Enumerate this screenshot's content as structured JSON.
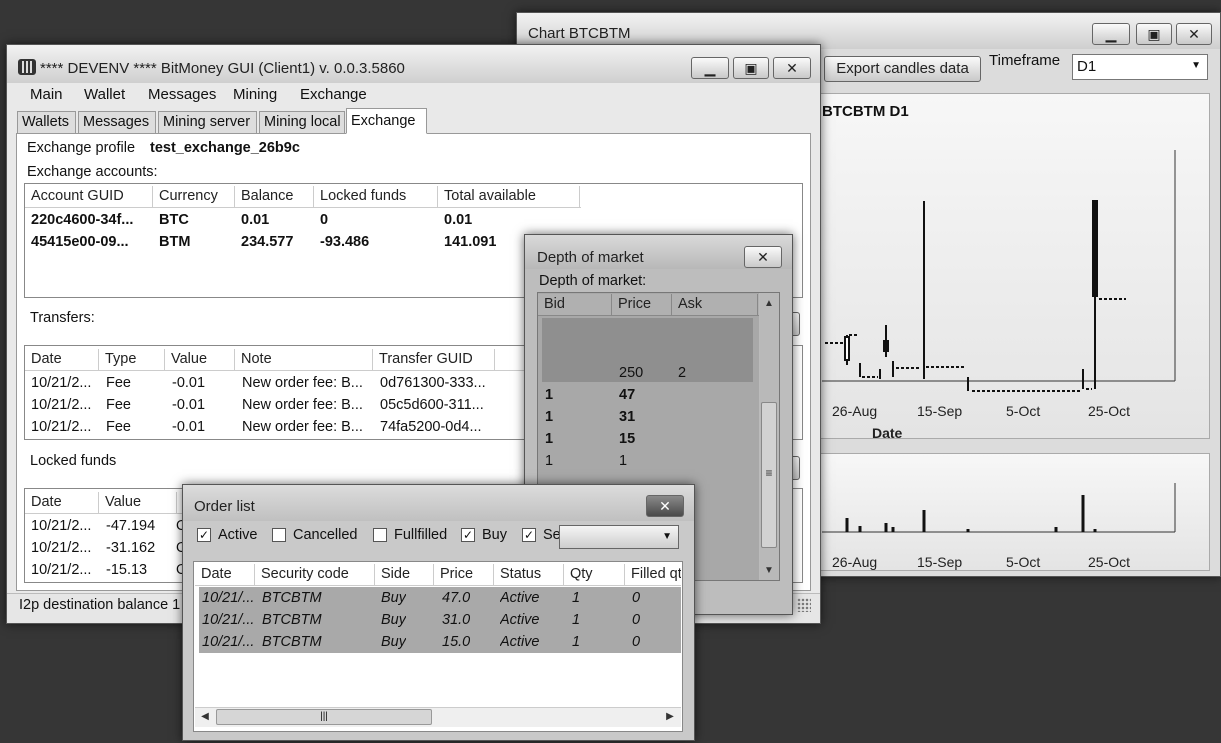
{
  "chart_window": {
    "title": "Chart BTCBTM",
    "export_button": "Export candles data",
    "timeframe_label": "Timeframe",
    "timeframe_value": "D1",
    "chart_title": "BTCBTM D1",
    "xlabel": "Date",
    "controls": {
      "minimize": "▁",
      "maximize": "▣",
      "close": "✕"
    }
  },
  "chart_data": {
    "type": "candlestick",
    "title": "BTCBTM D1",
    "xlabel": "Date",
    "ylabel": "",
    "x_ticks": [
      "26-Aug",
      "15-Sep",
      "5-Oct",
      "25-Oct"
    ],
    "volume_x_ticks": [
      "26-Aug",
      "15-Sep",
      "5-Oct",
      "25-Oct"
    ],
    "grid": false
  },
  "main_window": {
    "title": "**** DEVENV **** BitMoney GUI (Client1) v. 0.0.3.5860",
    "controls": {
      "minimize": "▁",
      "maximize": "▣",
      "close": "✕"
    },
    "menu": [
      "Main",
      "Wallet",
      "Messages",
      "Mining",
      "Exchange"
    ],
    "tabs": [
      "Wallets",
      "Messages",
      "Mining server",
      "Mining local",
      "Exchange"
    ],
    "profile_label": "Exchange profile",
    "profile_value": "test_exchange_26b9c",
    "accounts_label": "Exchange accounts:",
    "accounts_columns": [
      "Account GUID",
      "Currency",
      "Balance",
      "Locked funds",
      "Total available"
    ],
    "accounts_rows": [
      [
        "220c4600-34f...",
        "BTC",
        "0.01",
        "0",
        "0.01"
      ],
      [
        "45415e00-09...",
        "BTM",
        "234.577",
        "-93.486",
        "141.091"
      ]
    ],
    "transfers_label": "Transfers:",
    "transfers_columns": [
      "Date",
      "Type",
      "Value",
      "Note",
      "Transfer GUID"
    ],
    "transfers_rows": [
      [
        "10/21/2...",
        "Fee",
        "-0.01",
        "New order fee: B...",
        "0d761300-333..."
      ],
      [
        "10/21/2...",
        "Fee",
        "-0.01",
        "New order fee: B...",
        "05c5d600-311..."
      ],
      [
        "10/21/2...",
        "Fee",
        "-0.01",
        "New order fee: B...",
        "74fa5200-0d4..."
      ]
    ],
    "locked_label": "Locked funds",
    "locked_columns": [
      "Date",
      "Value",
      "N"
    ],
    "locked_rows": [
      [
        "10/21/2...",
        "-47.194",
        "O"
      ],
      [
        "10/21/2...",
        "-31.162",
        "O"
      ],
      [
        "10/21/2...",
        "-15.13",
        "O"
      ]
    ],
    "status_text": "I2p destination balance 1"
  },
  "depth_window": {
    "title": "Depth of market",
    "label": "Depth of market:",
    "columns": [
      "Bid",
      "Price",
      "Ask"
    ],
    "ask_rows": [
      [
        "",
        "250",
        "2"
      ]
    ],
    "bid_rows": [
      [
        "1",
        "47",
        ""
      ],
      [
        "1",
        "31",
        ""
      ],
      [
        "1",
        "15",
        ""
      ],
      [
        "1",
        "1",
        ""
      ]
    ],
    "close": "✕"
  },
  "order_window": {
    "title": "Order list",
    "close": "✕",
    "filters": [
      {
        "label": "Active",
        "checked": true
      },
      {
        "label": "Cancelled",
        "checked": false
      },
      {
        "label": "Fullfilled",
        "checked": false
      },
      {
        "label": "Buy",
        "checked": true
      },
      {
        "label": "Sell",
        "checked": true
      }
    ],
    "dropdown_value": "",
    "columns": [
      "Date",
      "Security code",
      "Side",
      "Price",
      "Status",
      "Qty",
      "Filled qt"
    ],
    "rows": [
      [
        "10/21/...",
        "BTCBTM",
        "Buy",
        "47.0",
        "Active",
        "1",
        "0"
      ],
      [
        "10/21/...",
        "BTCBTM",
        "Buy",
        "31.0",
        "Active",
        "1",
        "0"
      ],
      [
        "10/21/...",
        "BTCBTM",
        "Buy",
        "15.0",
        "Active",
        "1",
        "0"
      ]
    ]
  },
  "icons": {
    "check": "✓",
    "dropdown": "▼",
    "up": "▲",
    "down": "▼",
    "left": "◀",
    "right": "▶",
    "grip": "≡"
  }
}
